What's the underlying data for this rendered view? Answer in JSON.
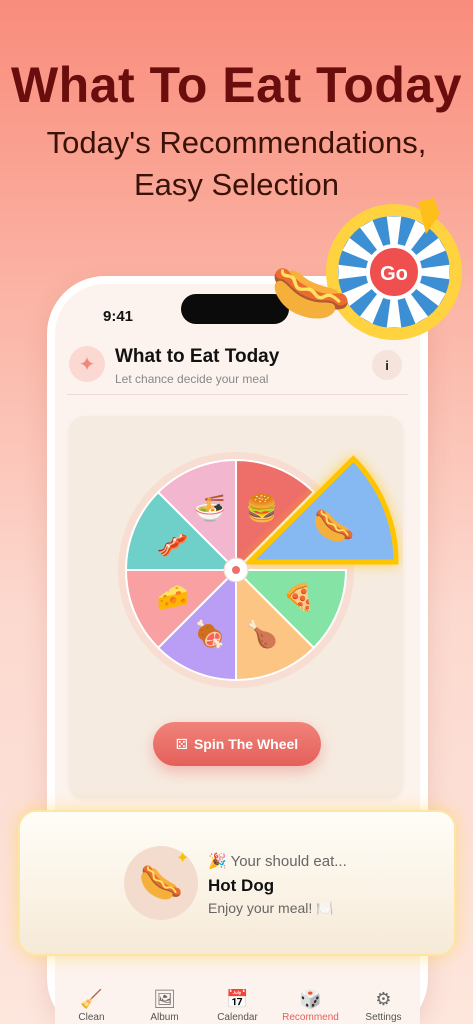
{
  "promo": {
    "headline": "What To Eat Today",
    "subline_1": "Today's Recommendations,",
    "subline_2": "Easy Selection"
  },
  "status": {
    "time": "9:41"
  },
  "header": {
    "title": "What to Eat Today",
    "subtitle": "Let chance decide your meal",
    "icon": "sparkle-icon",
    "info_icon": "info-icon"
  },
  "wheel": {
    "segments": [
      {
        "food": "burger",
        "emoji": "🍔",
        "color": "#ee6e6a"
      },
      {
        "food": "hot dog",
        "emoji": "🌭",
        "color": "#86b8f2"
      },
      {
        "food": "pizza",
        "emoji": "🍕",
        "color": "#86e3a6"
      },
      {
        "food": "drumstick",
        "emoji": "🍗",
        "color": "#fdc583"
      },
      {
        "food": "meat on bone",
        "emoji": "🍖",
        "color": "#ba9df5"
      },
      {
        "food": "cheese",
        "emoji": "🧀",
        "color": "#f8a0a2"
      },
      {
        "food": "bacon",
        "emoji": "🥓",
        "color": "#6fcfc9"
      },
      {
        "food": "noodles",
        "emoji": "🍜",
        "color": "#f2b6cf"
      }
    ],
    "selected_index": 1
  },
  "spin_button": {
    "label": "Spin The Wheel",
    "icon": "dice-icon"
  },
  "deco": {
    "spinner_label": "Go"
  },
  "result": {
    "prefix": "🎉 Your should eat...",
    "food": "Hot Dog",
    "food_emoji": "🌭",
    "enjoy": "Enjoy your meal! 🍽️"
  },
  "tabs": [
    {
      "label": "Clean",
      "icon": "broom-icon",
      "glyph": "🧹",
      "active": false
    },
    {
      "label": "Album",
      "icon": "album-icon",
      "glyph": "🖼",
      "active": false
    },
    {
      "label": "Calendar",
      "icon": "calendar-icon",
      "glyph": "📅",
      "active": false
    },
    {
      "label": "Recommend",
      "icon": "dice-icon",
      "glyph": "🎲",
      "active": true
    },
    {
      "label": "Settings",
      "icon": "gear-icon",
      "glyph": "⚙",
      "active": false
    }
  ],
  "colors": {
    "accent": "#e55f5a",
    "title": "#6a0d0d",
    "highlight": "#ffc400"
  }
}
